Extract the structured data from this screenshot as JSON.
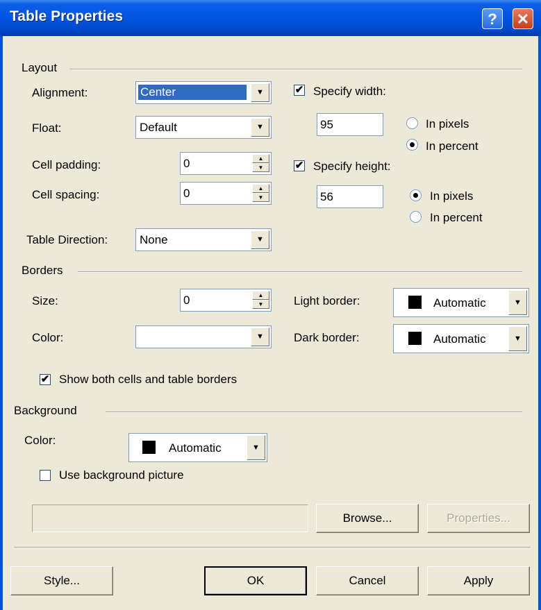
{
  "dialog": {
    "title": "Table Properties",
    "help_glyph": "?",
    "close_glyph": "✕"
  },
  "layout": {
    "group_label": "Layout",
    "alignment_label": "Alignment:",
    "alignment_value": "Center",
    "float_label": "Float:",
    "float_value": "Default",
    "cell_padding_label": "Cell padding:",
    "cell_padding_value": "0",
    "cell_spacing_label": "Cell spacing:",
    "cell_spacing_value": "0",
    "table_direction_label": "Table Direction:",
    "table_direction_value": "None",
    "specify_width_label": "Specify width:",
    "specify_width_checked": true,
    "width_value": "95",
    "width_in_pixels_label": "In pixels",
    "width_in_percent_label": "In percent",
    "width_unit_selected": "percent",
    "specify_height_label": "Specify height:",
    "specify_height_checked": true,
    "height_value": "56",
    "height_in_pixels_label": "In pixels",
    "height_in_percent_label": "In percent",
    "height_unit_selected": "pixels"
  },
  "borders": {
    "group_label": "Borders",
    "size_label": "Size:",
    "size_value": "0",
    "color_label": "Color:",
    "color_value": "",
    "light_border_label": "Light border:",
    "light_border_value": "Automatic",
    "dark_border_label": "Dark border:",
    "dark_border_value": "Automatic",
    "show_both_label": "Show both cells and table borders",
    "show_both_checked": true
  },
  "background": {
    "group_label": "Background",
    "color_label": "Color:",
    "color_value": "Automatic",
    "use_picture_label": "Use background picture",
    "use_picture_checked": false,
    "picture_path": "",
    "browse_label": "Browse...",
    "properties_label": "Properties..."
  },
  "footer": {
    "style_label": "Style...",
    "ok_label": "OK",
    "cancel_label": "Cancel",
    "apply_label": "Apply"
  },
  "colors": {
    "title_bar": "#0054e3",
    "face": "#ece9d8",
    "selection": "#316ac5"
  },
  "glyphs": {
    "check": "✔",
    "arrow_down": "▼",
    "spin_up": "▲",
    "spin_down": "▼"
  }
}
